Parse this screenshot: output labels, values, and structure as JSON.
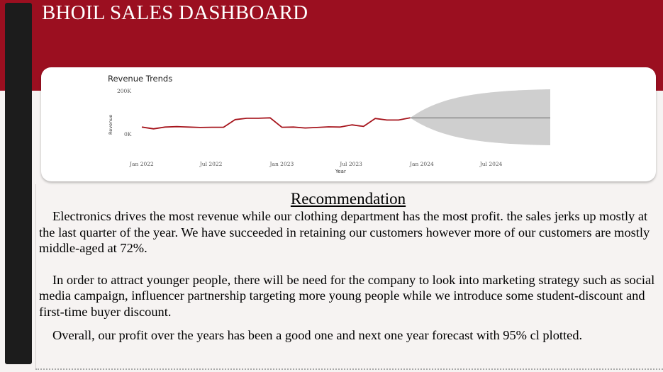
{
  "dashboard": {
    "title": "BHOIL SALES DASHBOARD",
    "colors": {
      "header": "#9b0f20",
      "sidebar": "#1c1c1c",
      "line": "#a6141c",
      "forecast_band": "#cfcfcf"
    }
  },
  "chart_data": {
    "type": "line",
    "title": "Revenue Trends",
    "xlabel": "Year",
    "ylabel": "Revenue",
    "ylim": [
      0,
      200000
    ],
    "y_ticks": [
      "200K",
      "0K"
    ],
    "x_ticks": [
      "Jan 2022",
      "Jul 2022",
      "Jan 2023",
      "Jul 2023",
      "Jan 2024",
      "Jul 2024"
    ],
    "grid": false,
    "series": [
      {
        "values": [
          {
            "x": "2022-01",
            "y": 28000
          },
          {
            "x": "2022-02",
            "y": 20000
          },
          {
            "x": "2022-03",
            "y": 28000
          },
          {
            "x": "2022-04",
            "y": 30000
          },
          {
            "x": "2022-05",
            "y": 28000
          },
          {
            "x": "2022-06",
            "y": 26000
          },
          {
            "x": "2022-07",
            "y": 27000
          },
          {
            "x": "2022-08",
            "y": 27000
          },
          {
            "x": "2022-09",
            "y": 62000
          },
          {
            "x": "2022-10",
            "y": 68000
          },
          {
            "x": "2022-11",
            "y": 68000
          },
          {
            "x": "2022-12",
            "y": 70000
          },
          {
            "x": "2023-01",
            "y": 27000
          },
          {
            "x": "2023-02",
            "y": 28000
          },
          {
            "x": "2023-03",
            "y": 24000
          },
          {
            "x": "2023-04",
            "y": 26000
          },
          {
            "x": "2023-05",
            "y": 29000
          },
          {
            "x": "2023-06",
            "y": 28000
          },
          {
            "x": "2023-07",
            "y": 38000
          },
          {
            "x": "2023-08",
            "y": 31000
          },
          {
            "x": "2023-09",
            "y": 67000
          },
          {
            "x": "2023-10",
            "y": 60000
          },
          {
            "x": "2023-11",
            "y": 60000
          },
          {
            "x": "2023-12",
            "y": 70000
          }
        ]
      }
    ],
    "forecast": {
      "start": "2023-12",
      "end": "2024-12",
      "value": 70000,
      "band_upper_end": 200000,
      "band_lower_end": -55000
    }
  },
  "recommendation": {
    "heading": "Recommendation",
    "paragraphs": [
      "Electronics drives the most revenue while our clothing department has the most profit. the sales jerks up mostly at the last quarter of the year. We have succeeded in retaining our customers however more of our customers are mostly middle-aged at  72%.",
      "In order to attract younger people, there will be need for the company to look into marketing strategy such as social media campaign, influencer partnership targeting more young people while we introduce some student-discount and first-time buyer discount.",
      "Overall, our profit over the years has been a good one  and next one year forecast with 95%  cl plotted."
    ]
  }
}
